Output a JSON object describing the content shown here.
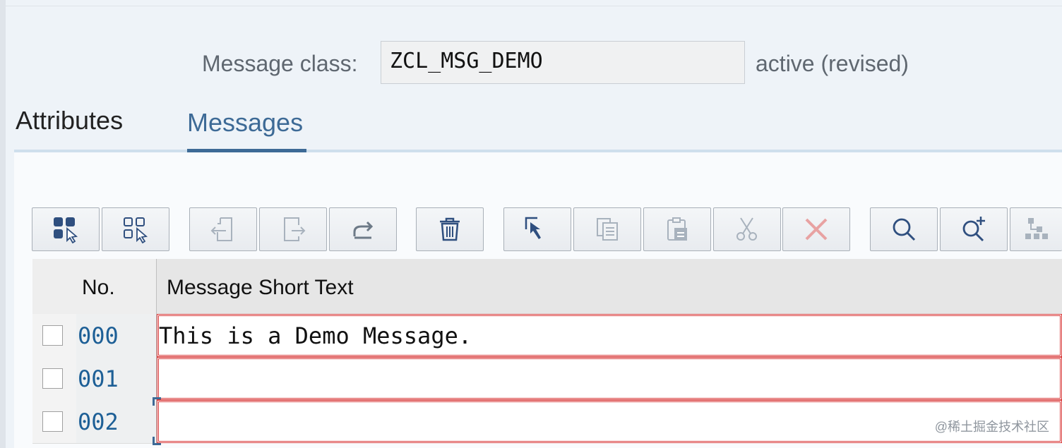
{
  "header": {
    "label": "Message class:",
    "value": "ZCL_MSG_DEMO",
    "status": "active (revised)"
  },
  "tabs": [
    {
      "label": "Attributes",
      "active": false
    },
    {
      "label": "Messages",
      "active": true
    }
  ],
  "toolbar": [
    {
      "icon": "select-all-icon",
      "enabled": true
    },
    {
      "icon": "deselect-all-icon",
      "enabled": true
    },
    {
      "icon": "insert-row-icon",
      "enabled": false
    },
    {
      "icon": "append-row-icon",
      "enabled": false
    },
    {
      "icon": "undo-icon",
      "enabled": false
    },
    {
      "icon": "delete-icon",
      "enabled": true
    },
    {
      "icon": "select-cursor-icon",
      "enabled": true
    },
    {
      "icon": "copy-icon",
      "enabled": false
    },
    {
      "icon": "paste-icon",
      "enabled": false
    },
    {
      "icon": "cut-icon",
      "enabled": false
    },
    {
      "icon": "cancel-icon",
      "enabled": false
    },
    {
      "icon": "search-icon",
      "enabled": true
    },
    {
      "icon": "search-next-icon",
      "enabled": true
    },
    {
      "icon": "layout-icon",
      "enabled": false
    }
  ],
  "table": {
    "columns": [
      "No.",
      "Message Short Text"
    ],
    "rows": [
      {
        "no": "000",
        "text": "This is a Demo Message."
      },
      {
        "no": "001",
        "text": ""
      },
      {
        "no": "002",
        "text": ""
      }
    ]
  },
  "watermark": "@稀土掘金技术社区",
  "colors": {
    "accent": "#3d6a96",
    "error_border": "#d93a3a",
    "number": "#1d5f96"
  }
}
